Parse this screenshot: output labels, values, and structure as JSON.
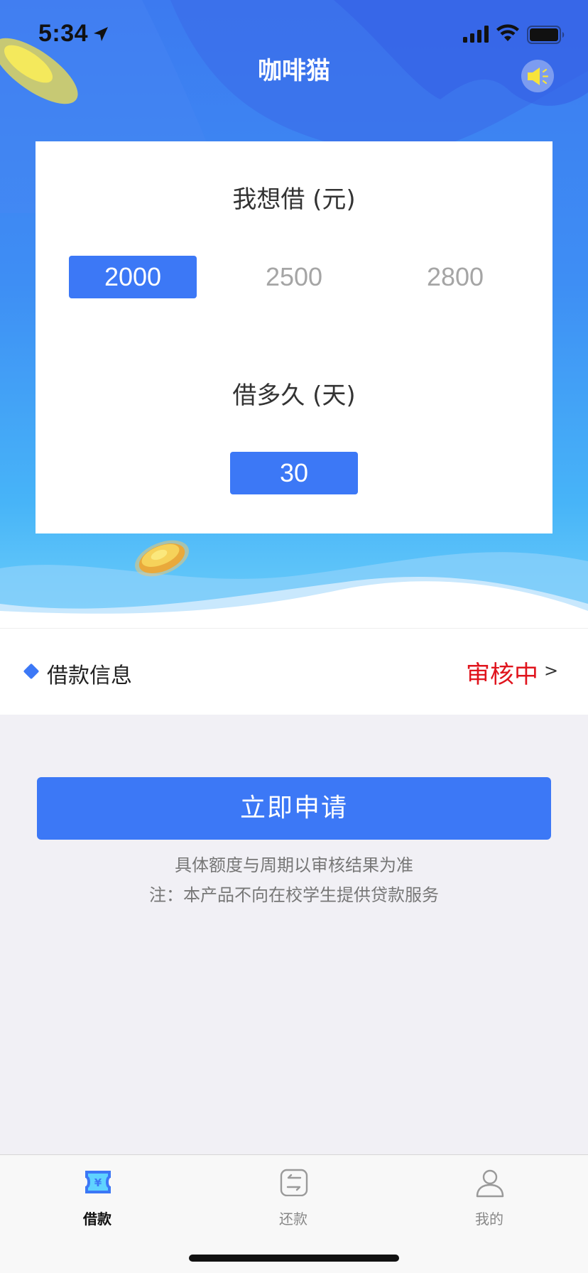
{
  "status_bar": {
    "time": "5:34"
  },
  "nav": {
    "title": "咖啡猫"
  },
  "loan_card": {
    "amount_label": "我想借 (元)",
    "amounts": [
      "2000",
      "2500",
      "2800"
    ],
    "selected_amount": "2000",
    "term_label": "借多久 (天)",
    "terms": [
      "30"
    ],
    "selected_term": "30"
  },
  "loan_info": {
    "label": "借款信息",
    "status": "审核中",
    "arrow": ">"
  },
  "apply": {
    "button_label": "立即申请",
    "note_1": "具体额度与周期以审核结果为准",
    "note_2": "注：本产品不向在校学生提供贷款服务"
  },
  "tabbar": {
    "items": [
      {
        "label": "借款",
        "icon": "loan-ticket-icon",
        "active": true
      },
      {
        "label": "还款",
        "icon": "repay-exchange-icon",
        "active": false
      },
      {
        "label": "我的",
        "icon": "user-profile-icon",
        "active": false
      }
    ]
  },
  "colors": {
    "accent": "#3c78f6",
    "status_red": "#e0141d",
    "hero_top": "#3c7af0",
    "hero_bottom": "#6fd0fa"
  }
}
